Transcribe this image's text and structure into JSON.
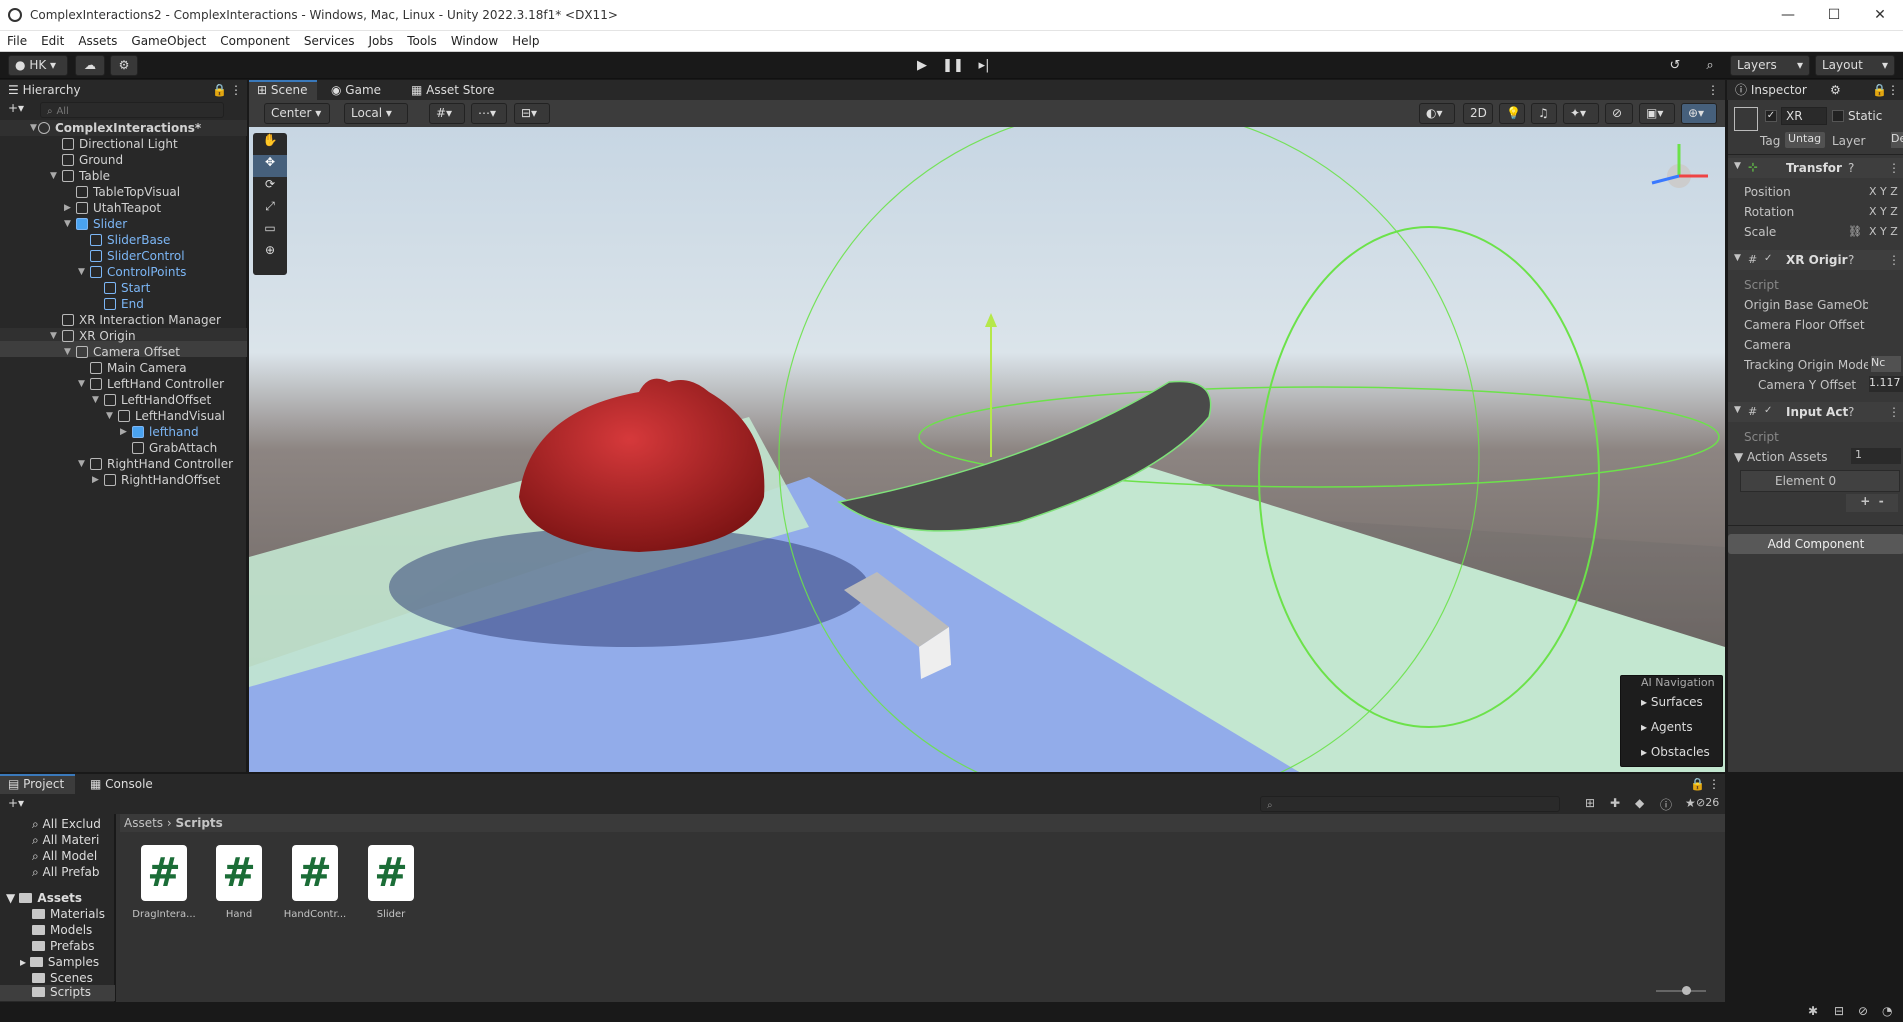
{
  "window": {
    "title": "ComplexInteractions2 - ComplexInteractions - Windows, Mac, Linux - Unity 2022.3.18f1* <DX11>",
    "min": "—",
    "max": "☐",
    "close": "✕"
  },
  "menu": [
    "File",
    "Edit",
    "Assets",
    "GameObject",
    "Component",
    "Services",
    "Jobs",
    "Tools",
    "Window",
    "Help"
  ],
  "toolbar": {
    "account": "HK",
    "layers": "Layers",
    "layout": "Layout"
  },
  "hierarchy": {
    "title": "Hierarchy",
    "search_placeholder": "All",
    "items": [
      {
        "label": "ComplexInteractions*"
      },
      {
        "label": "Directional Light"
      },
      {
        "label": "Ground"
      },
      {
        "label": "Table"
      },
      {
        "label": "TableTopVisual"
      },
      {
        "label": "UtahTeapot"
      },
      {
        "label": "Slider"
      },
      {
        "label": "SliderBase"
      },
      {
        "label": "SliderControl"
      },
      {
        "label": "ControlPoints"
      },
      {
        "label": "Start"
      },
      {
        "label": "End"
      },
      {
        "label": "XR Interaction Manager"
      },
      {
        "label": "XR Origin"
      },
      {
        "label": "Camera Offset"
      },
      {
        "label": "Main Camera"
      },
      {
        "label": "LeftHand Controller"
      },
      {
        "label": "LeftHandOffset"
      },
      {
        "label": "LeftHandVisual"
      },
      {
        "label": "lefthand"
      },
      {
        "label": "GrabAttach"
      },
      {
        "label": "RightHand Controller"
      },
      {
        "label": "RightHandOffset"
      }
    ]
  },
  "tabs": {
    "scene": "Scene",
    "game": "Game",
    "asset_store": "Asset Store"
  },
  "scene_toolbar": {
    "pivot": "Center",
    "space": "Local",
    "mode2d": "2D"
  },
  "ai_nav": {
    "title": "AI Navigation",
    "items": [
      "Surfaces",
      "Agents",
      "Obstacles"
    ]
  },
  "inspector": {
    "title": "Inspector",
    "object_name": "XR Orig",
    "static": "Static",
    "tag_label": "Tag",
    "tag_value": "Untag",
    "layer_label": "Layer",
    "layer_value": "De",
    "transform": "Transfor",
    "position": "Position",
    "rotation": "Rotation",
    "scale": "Scale",
    "xyz": "X Y Z",
    "xr_origin": "XR Origir",
    "script": "Script",
    "origin_base": "Origin Base GameObj",
    "camera_floor": "Camera Floor Offset C",
    "camera": "Camera",
    "tracking": "Tracking Origin Mode",
    "tracking_val": "Nc",
    "camera_y": "Camera Y Offset",
    "camera_y_val": "1.117",
    "input_act": "Input Act",
    "script2": "Script",
    "action_assets": "Action Assets",
    "action_count": "1",
    "element0": "Element 0",
    "plus": "+",
    "minus": "-",
    "add_component": "Add Component"
  },
  "project": {
    "tab_project": "Project",
    "tab_console": "Console",
    "breadcrumb_root": "Assets",
    "breadcrumb_sep": "›",
    "breadcrumb_leaf": "Scripts",
    "count": "26",
    "favorites": [
      "All Exclud",
      "All Materi",
      "All Model",
      "All Prefab"
    ],
    "folders": [
      "Assets",
      "Materials",
      "Models",
      "Prefabs",
      "Samples",
      "Scenes",
      "Scripts"
    ],
    "assets": [
      {
        "name": "DragIntera..."
      },
      {
        "name": "Hand"
      },
      {
        "name": "HandContr..."
      },
      {
        "name": "Slider"
      }
    ],
    "cs_glyph": "#"
  }
}
